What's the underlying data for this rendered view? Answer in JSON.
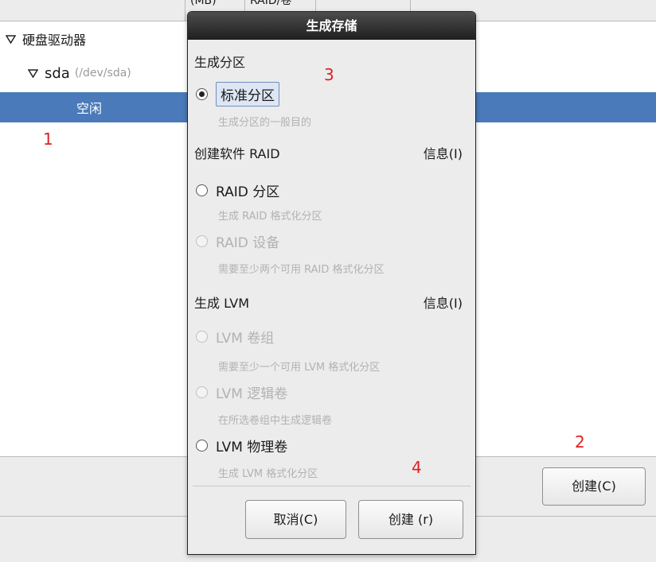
{
  "background": {
    "columns": {
      "mb": "(MB)",
      "raid": "RAID/卷"
    },
    "tree": {
      "disk_label": "硬盘驱动器",
      "sda_name": "sda",
      "sda_dev": "(/dev/sda)",
      "free_label": "空闲"
    },
    "create_button": "创建(C)"
  },
  "annotations": {
    "n1": "1",
    "n2": "2",
    "n3": "3",
    "n4": "4"
  },
  "dialog": {
    "title": "生成存储",
    "partition_section": "生成分区",
    "standard_partition": "标准分区",
    "standard_partition_desc": "生成分区的一般目的",
    "raid_section": "创建软件 RAID",
    "raid_info": "信息(I)",
    "raid_partition": "RAID 分区",
    "raid_partition_desc": "生成 RAID 格式化分区",
    "raid_device": "RAID 设备",
    "raid_device_desc": "需要至少两个可用 RAID 格式化分区",
    "lvm_section": "生成 LVM",
    "lvm_info": "信息(I)",
    "lvm_vg": "LVM 卷组",
    "lvm_vg_desc": "需要至少一个可用 LVM 格式化分区",
    "lvm_lv": "LVM 逻辑卷",
    "lvm_lv_desc": "在所选卷组中生成逻辑卷",
    "lvm_pv": "LVM 物理卷",
    "lvm_pv_desc": "生成 LVM 格式化分区",
    "cancel_button": "取消(C)",
    "create_button": "创建 (r)"
  }
}
